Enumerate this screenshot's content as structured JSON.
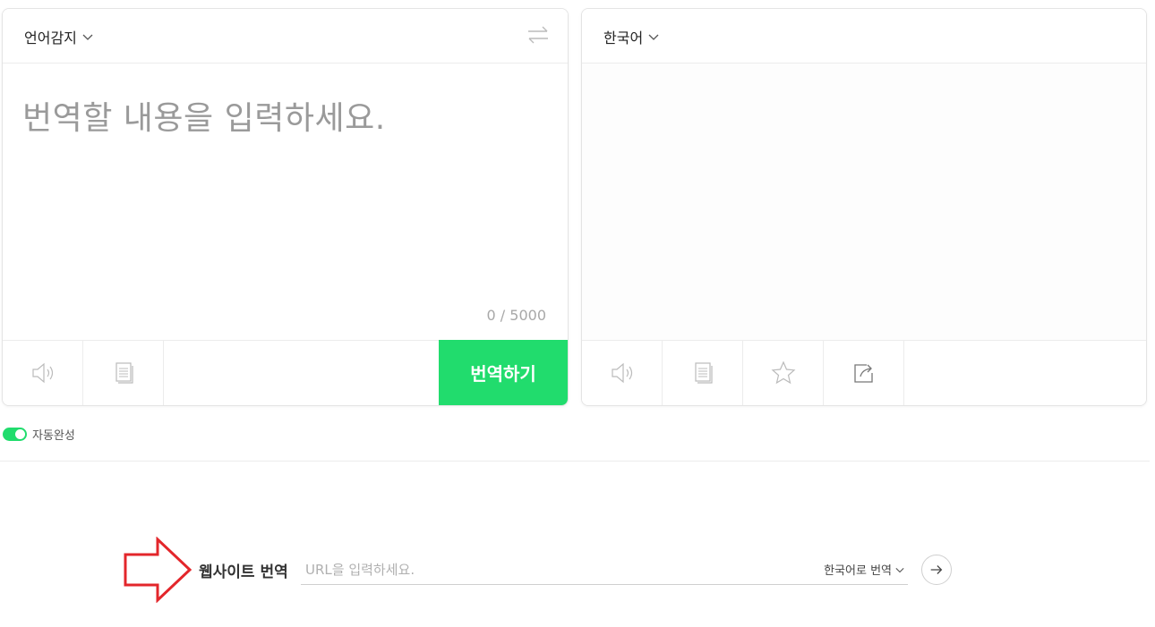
{
  "source": {
    "language_label": "언어감지",
    "placeholder": "번역할 내용을 입력하세요.",
    "counter": "0 / 5000",
    "translate_button": "번역하기"
  },
  "target": {
    "language_label": "한국어"
  },
  "autocomplete": {
    "label": "자동완성",
    "enabled": true
  },
  "website": {
    "label": "웹사이트 번역",
    "url_placeholder": "URL을 입력하세요.",
    "lang_select": "한국어로 번역"
  },
  "icons": {
    "swap": "swap-icon",
    "speaker": "speaker-icon",
    "copy": "copy-icon",
    "star": "star-icon",
    "share": "share-icon",
    "go": "arrow-right-icon"
  },
  "colors": {
    "accent": "#21dc6d",
    "annotation_arrow": "#e3262b"
  }
}
